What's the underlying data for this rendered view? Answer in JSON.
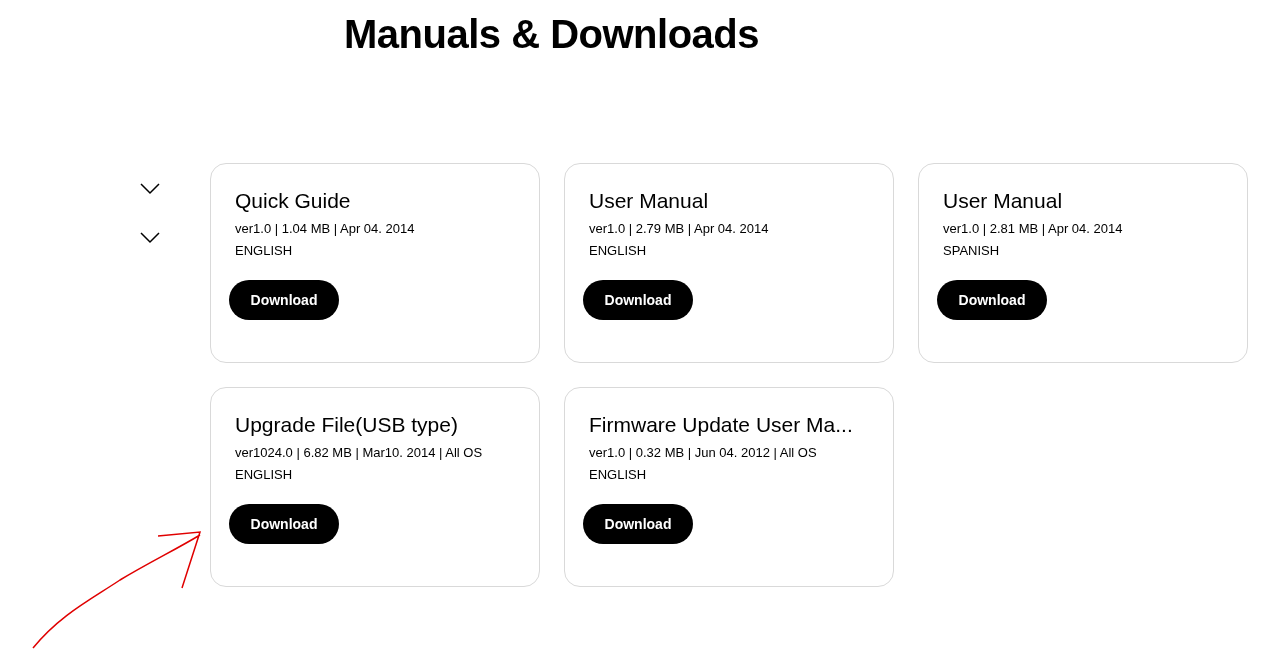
{
  "title": "Manuals & Downloads",
  "toggles": [
    {
      "expanded": false
    },
    {
      "expanded": false
    }
  ],
  "documents": [
    {
      "name": "Quick Guide",
      "details": "ver1.0 | 1.04 MB | Apr 04. 2014",
      "language": "ENGLISH",
      "button": "Download"
    },
    {
      "name": "User Manual",
      "details": "ver1.0 | 2.79 MB | Apr 04. 2014",
      "language": "ENGLISH",
      "button": "Download"
    },
    {
      "name": "User Manual",
      "details": "ver1.0 | 2.81 MB | Apr 04. 2014",
      "language": "SPANISH",
      "button": "Download"
    },
    {
      "name": "Upgrade File(USB type)",
      "details": "ver1024.0 | 6.82 MB | Mar10. 2014 | All OS",
      "language": "ENGLISH",
      "button": "Download"
    },
    {
      "name": "Firmware Update User Ma...",
      "details": "ver1.0 | 0.32 MB | Jun 04. 2012 | All OS",
      "language": "ENGLISH",
      "button": "Download"
    }
  ]
}
